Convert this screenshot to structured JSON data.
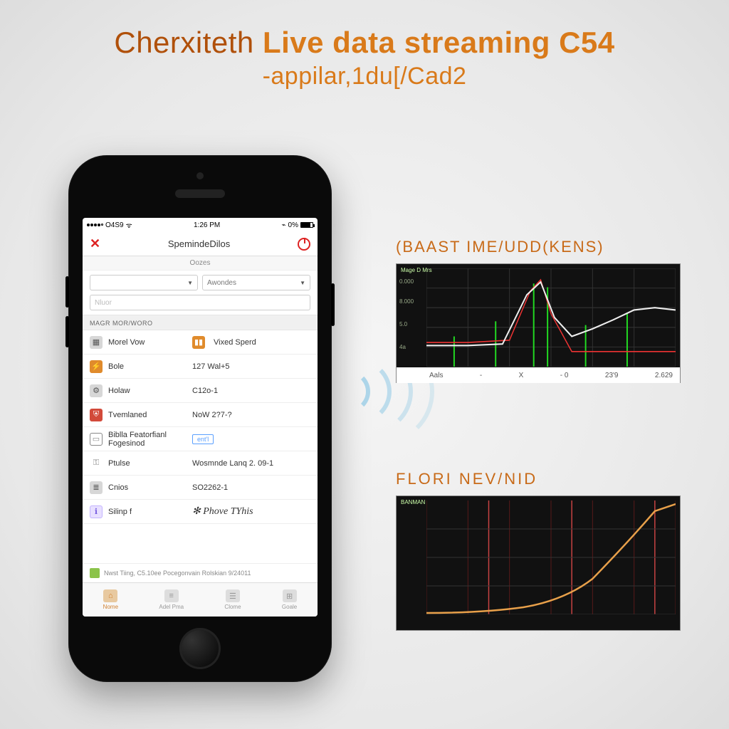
{
  "headline": {
    "brand": "Cherxiteth",
    "rest": "Live data streaming C54",
    "sub": "-appilar,1du[/Cad2"
  },
  "phone": {
    "status": {
      "carrier": "O4S9",
      "time": "1:26 PM",
      "batt": "0%"
    },
    "nav": {
      "title": "SpemindeDilos"
    },
    "subhead": "Oozes",
    "select1": "",
    "select2": "Awondes",
    "input_placeholder": "Nluor",
    "section": "MAGR MOR/WORO",
    "rows": [
      {
        "icon": "grid",
        "iconCls": "ic-gray",
        "label": "Morel Vow",
        "value": "Vixed Sperd",
        "value_iconCls": "ic-orange",
        "value_icon": "bar"
      },
      {
        "icon": "bolt",
        "iconCls": "ic-orange",
        "label": "Bole",
        "value": "127 Wal+5"
      },
      {
        "icon": "gear",
        "iconCls": "ic-gray",
        "label": "Holaw",
        "value": "C12o-1"
      },
      {
        "icon": "shield",
        "iconCls": "ic-red",
        "label": "Tvemlaned",
        "value": "NoW 2?7-?"
      },
      {
        "icon": "box",
        "iconCls": "ic-outline",
        "label": "Biblla Featorfianl Fogesinod",
        "chip": "ent'l"
      },
      {
        "icon": "key",
        "iconCls": "ic-key",
        "label": "Ptulse",
        "value": "Wosmnde Lanq 2. 09-1"
      },
      {
        "icon": "file",
        "iconCls": "ic-gray",
        "label": "Cnios",
        "value": "SO2262-1"
      },
      {
        "icon": "info",
        "iconCls": "ic-purple",
        "label": "Silinp f",
        "value": "✻ Phove TYhis",
        "italic": true
      }
    ],
    "footer": "Nwst Tiing, C5.10ee Pocegonvain Rolskian 9/24011",
    "tabs": [
      {
        "label": "Nome",
        "icon": "home"
      },
      {
        "label": "Adel Pma",
        "icon": "list"
      },
      {
        "label": "Clome",
        "icon": "user"
      },
      {
        "label": "Goale",
        "icon": "grid"
      }
    ]
  },
  "chart1": {
    "title": "(BAAST IME/UDD(KENS)",
    "corner": "Mage D Mrs",
    "ylabels": [
      "0.000",
      "8.000",
      "5.0",
      "4a"
    ],
    "xlabels": [
      "Aals",
      "-",
      "X",
      "- 0",
      "23'9",
      "2.629"
    ]
  },
  "chart2": {
    "title": "FLORI NEV/NID",
    "corner": "BANMAN"
  },
  "chart_data": [
    {
      "type": "line",
      "title": "(BAAST IME/UDD(KENS)",
      "series": [
        {
          "name": "red",
          "values": [
            22,
            22,
            22,
            22,
            20,
            70,
            25,
            10,
            10,
            10,
            10,
            10
          ]
        },
        {
          "name": "white",
          "values": [
            18,
            18,
            18,
            20,
            25,
            72,
            30,
            32,
            40,
            42,
            50,
            48
          ]
        },
        {
          "name": "green_markers",
          "values": [
            null,
            20,
            null,
            30,
            null,
            70,
            null,
            30,
            null,
            40,
            null,
            45
          ]
        }
      ],
      "x": [
        0,
        1,
        2,
        3,
        4,
        5,
        6,
        7,
        8,
        9,
        10,
        11
      ],
      "ylim": [
        0,
        100
      ]
    },
    {
      "type": "line",
      "title": "FLORI NEV/NID",
      "series": [
        {
          "name": "orange",
          "values": [
            2,
            3,
            4,
            5,
            7,
            10,
            15,
            25,
            45,
            75,
            95,
            100
          ]
        }
      ],
      "x": [
        0,
        1,
        2,
        3,
        4,
        5,
        6,
        7,
        8,
        9,
        10,
        11
      ],
      "ylim": [
        0,
        100
      ]
    }
  ]
}
